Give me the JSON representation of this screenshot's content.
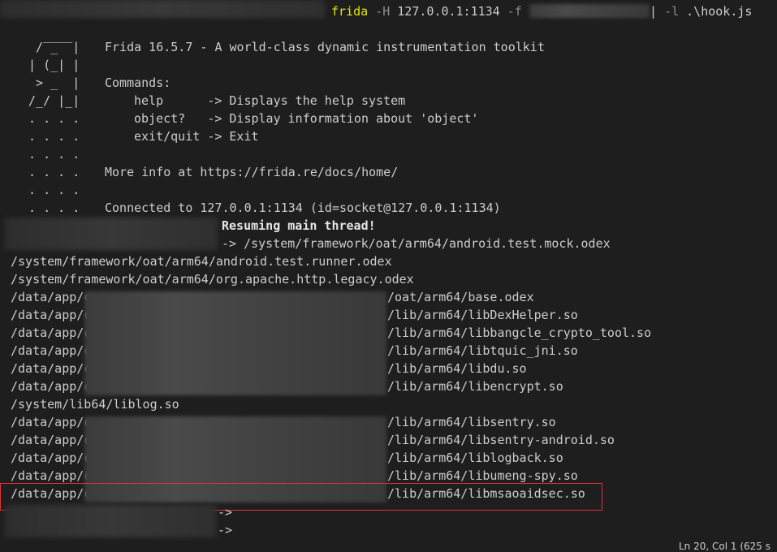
{
  "terminal": {
    "command": {
      "name": "frida",
      "flag_h": "-H",
      "host": "127.0.0.1:1134",
      "flag_f": "-f",
      "flag_l": "-l",
      "script": ".\\hook.js"
    },
    "banner": {
      "logo_lines": [
        "   ____",
        "  / _  |",
        " | (_| |",
        "  > _  |",
        " /_/ |_|",
        " . . . .",
        " . . . .",
        " . . . .",
        " . . . .",
        " . . . .",
        " . . . ."
      ],
      "title": "Frida 16.5.7 - A world-class dynamic instrumentation toolkit",
      "commands_header": "Commands:",
      "commands": [
        {
          "cmd": "help     ",
          "desc": "-> Displays the help system"
        },
        {
          "cmd": "object?  ",
          "desc": "-> Display information about 'object'"
        },
        {
          "cmd": "exit/quit",
          "desc": "-> Exit"
        }
      ],
      "more_info": "More info at https://frida.re/docs/home/",
      "connected": "Connected to 127.0.0.1:1134 (id=socket@127.0.0.1:1134)"
    },
    "resuming": "Resuming main thread!",
    "output_lines": [
      "-> /system/framework/oat/arm64/android.test.mock.odex",
      "/system/framework/oat/arm64/android.test.runner.odex",
      "/system/framework/oat/arm64/org.apache.http.legacy.odex",
      "/data/app/c",
      "/data/app/c",
      "/data/app/c",
      "/data/app/c",
      "/data/app/c",
      "/data/app/c",
      "/system/lib64/liblog.so",
      "/data/app/c",
      "/data/app/c",
      "/data/app/c",
      "/data/app/c",
      "/data/app/c"
    ],
    "output_suffixes": [
      "/oat/arm64/base.odex",
      "/lib/arm64/libDexHelper.so",
      "/lib/arm64/libbangcle_crypto_tool.so",
      "/lib/arm64/libtquic_jni.so",
      "/lib/arm64/libdu.so",
      "/lib/arm64/libencrypt.so",
      "/lib/arm64/libsentry.so",
      "/lib/arm64/libsentry-android.so",
      "/lib/arm64/liblogback.so",
      "/lib/arm64/libumeng-spy.so",
      "/lib/arm64/libmsaoaidsec.so"
    ],
    "prompt_arrows": [
      "->",
      "->"
    ]
  },
  "statusbar": {
    "position": "Ln 20, Col 1 (625 s"
  },
  "colors": {
    "background": "#1e1e1e",
    "text": "#cccccc",
    "command": "#e5e510",
    "highlight_border": "#e0303a"
  }
}
